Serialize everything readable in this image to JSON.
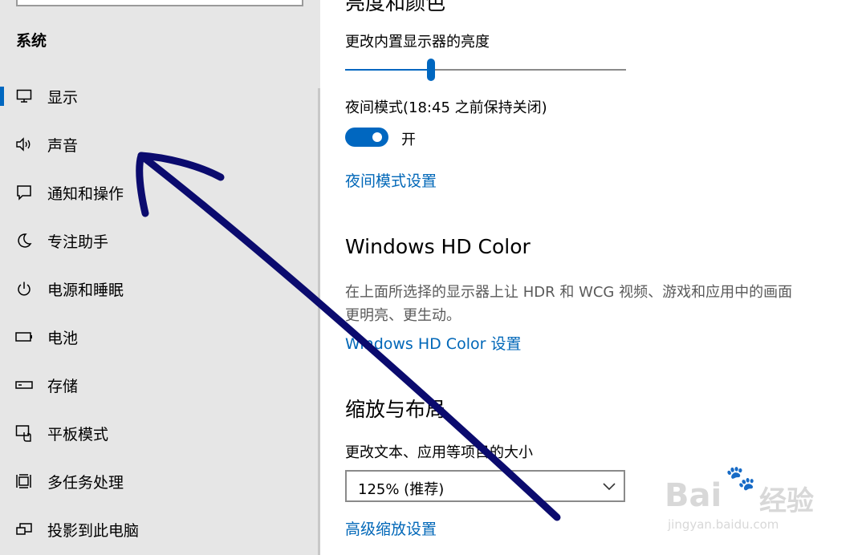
{
  "sidebar": {
    "heading": "系统",
    "items": [
      {
        "label": "显示",
        "icon": "monitor-icon",
        "selected": true
      },
      {
        "label": "声音",
        "icon": "speaker-icon",
        "selected": false
      },
      {
        "label": "通知和操作",
        "icon": "notification-icon",
        "selected": false
      },
      {
        "label": "专注助手",
        "icon": "moon-icon",
        "selected": false
      },
      {
        "label": "电源和睡眠",
        "icon": "power-icon",
        "selected": false
      },
      {
        "label": "电池",
        "icon": "battery-icon",
        "selected": false
      },
      {
        "label": "存储",
        "icon": "storage-icon",
        "selected": false
      },
      {
        "label": "平板模式",
        "icon": "tablet-icon",
        "selected": false
      },
      {
        "label": "多任务处理",
        "icon": "multitask-icon",
        "selected": false
      },
      {
        "label": "投影到此电脑",
        "icon": "project-icon",
        "selected": false
      }
    ]
  },
  "main": {
    "brightness_section_title": "亮度和颜色",
    "brightness_label": "更改内置显示器的亮度",
    "brightness_level": 0.307,
    "night_mode_label": "夜间模式(18:45 之前保持关闭)",
    "night_mode_toggle": {
      "state": "on",
      "text": "开"
    },
    "night_mode_settings_link": "夜间模式设置",
    "hdr_title": "Windows HD Color",
    "hdr_desc": "在上面所选择的显示器上让 HDR 和 WCG 视频、游戏和应用中的画面更明亮、更生动。",
    "hdr_settings_link": "Windows HD Color 设置",
    "scale_title": "缩放与布局",
    "scale_label": "更改文本、应用等项目的大小",
    "scale_dropdown_value": "125% (推荐)",
    "advanced_scale_link": "高级缩放设置"
  },
  "watermark": {
    "brand": "Bai",
    "brand_cn": "经验",
    "url": "jingyan.baidu.com"
  },
  "colors": {
    "accent": "#0067c0",
    "link": "#0067b8",
    "arrow": "#0b0b6e",
    "sidebar_bg": "#e6e6e6"
  }
}
